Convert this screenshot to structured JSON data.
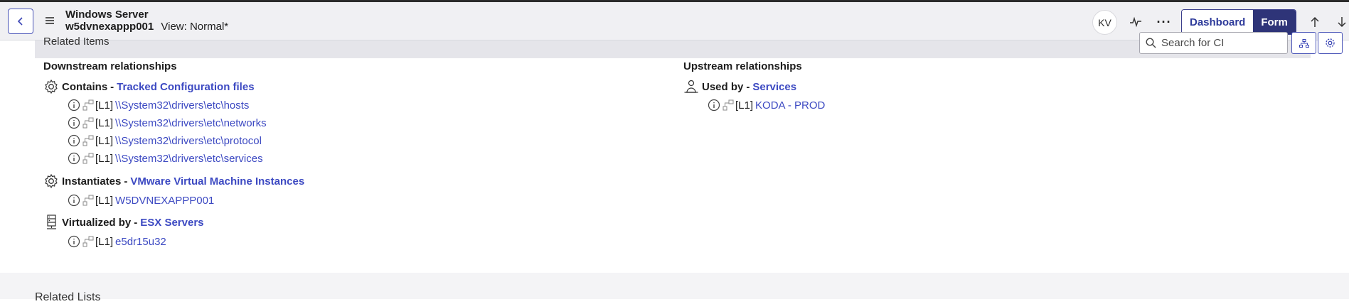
{
  "header": {
    "title": "Windows Server",
    "record": "w5dvnexappp001",
    "view": "View: Normal*",
    "avatar": "KV",
    "more_label": "···",
    "dashboard_label": "Dashboard",
    "form_label": "Form"
  },
  "related_items": {
    "title": "Related Items",
    "search_placeholder": "Search for CI"
  },
  "downstream": {
    "heading": "Downstream relationships",
    "groups": [
      {
        "icon": "gear-icon",
        "relation": "Contains",
        "class_link": "Tracked Configuration files",
        "items": [
          {
            "level": "[L1]",
            "name": "\\\\System32\\drivers\\etc\\hosts"
          },
          {
            "level": "[L1]",
            "name": "\\\\System32\\drivers\\etc\\networks"
          },
          {
            "level": "[L1]",
            "name": "\\\\System32\\drivers\\etc\\protocol"
          },
          {
            "level": "[L1]",
            "name": "\\\\System32\\drivers\\etc\\services"
          }
        ]
      },
      {
        "icon": "gear-icon",
        "relation": "Instantiates",
        "class_link": "VMware Virtual Machine Instances",
        "items": [
          {
            "level": "[L1]",
            "name": "W5DVNEXAPPP001"
          }
        ]
      },
      {
        "icon": "server-icon",
        "relation": "Virtualized by",
        "class_link": "ESX Servers",
        "items": [
          {
            "level": "[L1]",
            "name": "e5dr15u32"
          }
        ]
      }
    ]
  },
  "upstream": {
    "heading": "Upstream relationships",
    "groups": [
      {
        "icon": "service-icon",
        "relation": "Used by",
        "class_link": "Services",
        "items": [
          {
            "level": "[L1]",
            "name": "KODA - PROD"
          }
        ]
      }
    ]
  },
  "footer": {
    "title": "Related Lists"
  },
  "colors": {
    "accent": "#3c49c2",
    "form_active": "#2e3478",
    "header_bg": "#f0f0f3"
  }
}
